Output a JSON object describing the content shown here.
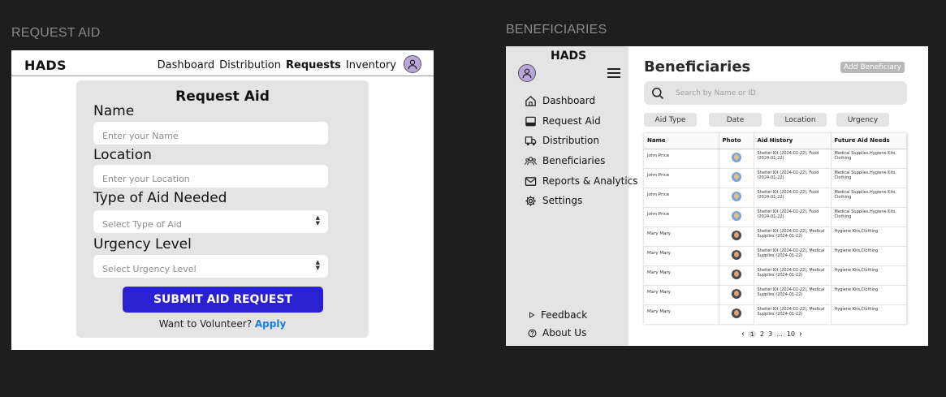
{
  "frames": {
    "left_label": "REQUEST AID",
    "right_label": "BENEFICIARIES"
  },
  "request": {
    "brand": "HADS",
    "nav": [
      "Dashboard",
      "Distribution",
      "Requests",
      "Inventory"
    ],
    "active_nav": "Requests",
    "title": "Request Aid",
    "fields": [
      {
        "label": "Name",
        "placeholder": "Enter your Name"
      },
      {
        "label": "Location",
        "placeholder": "Enter your Location"
      },
      {
        "label": "Type of Aid Needed",
        "placeholder": "Select Type of Aid"
      },
      {
        "label": "Urgency Level",
        "placeholder": "Select  Urgency Level"
      }
    ],
    "submit_label": "SUBMIT AID REQUEST",
    "volunteer_text": "Want to Volunteer?",
    "volunteer_link": "Apply"
  },
  "beneficiaries": {
    "brand": "HADS",
    "sidebar": [
      {
        "label": "Dashboard",
        "icon": "home-icon"
      },
      {
        "label": "Request Aid",
        "icon": "inbox-icon"
      },
      {
        "label": "Distribution",
        "icon": "truck-icon"
      },
      {
        "label": "Beneficiaries",
        "icon": "users-icon"
      },
      {
        "label": "Reports & Analytics",
        "icon": "mail-icon"
      },
      {
        "label": "Settings",
        "icon": "gear-icon"
      }
    ],
    "footer": [
      {
        "label": "Feedback",
        "icon": "play-icon"
      },
      {
        "label": "About Us",
        "icon": "help-icon"
      }
    ],
    "title": "Beneficiaries",
    "add_label": "Add Beneficiary",
    "search_placeholder": "Search by Name or ID",
    "filters": [
      "Aid Type",
      "Date",
      "Location",
      "Urgency"
    ],
    "columns": [
      "Name",
      "Photo",
      "Aid History",
      "Future Aid Needs"
    ],
    "rows": [
      {
        "name": "John Price",
        "history": "Shelter Kit (2024-01-22), Food (2024-01-22)",
        "needs": "Medical Supplies,Hygiene Kits, Clothing"
      },
      {
        "name": "John Price",
        "history": "Shelter Kit (2024-01-22), Food (2024-01-22)",
        "needs": "Medical Supplies,Hygiene Kits, Clothing"
      },
      {
        "name": "John Price",
        "history": "Shelter Kit (2024-01-22), Food (2024-01-22)",
        "needs": "Medical Supplies,Hygiene Kits, Clothing"
      },
      {
        "name": "John Price",
        "history": "Shelter Kit (2024-01-22), Food (2024-01-22)",
        "needs": "Medical Supplies,Hygiene Kits, Clothing"
      },
      {
        "name": "Mary Mary",
        "history": "Shelter Kit (2024-01-22), Medical Supplies (2024-01-22)",
        "needs": "Hygiene Kits,Clothing"
      },
      {
        "name": "Mary Mary",
        "history": "Shelter Kit (2024-01-22), Medical Supplies (2024-01-22)",
        "needs": "Hygiene Kits,Clothing"
      },
      {
        "name": "Mary Mary",
        "history": "Shelter Kit (2024-01-22), Medical Supplies (2024-01-22)",
        "needs": "Hygiene Kits,Clothing"
      },
      {
        "name": "Mary Mary",
        "history": "Shelter Kit (2024-01-22), Medical Supplies (2024-01-22)",
        "needs": "Hygiene Kits,Clothing"
      },
      {
        "name": "Mary Mary",
        "history": "Shelter Kit (2024-01-22), Medical Supplies (2024-01-22)",
        "needs": "Hygiene Kits,Clothing"
      }
    ],
    "pager": {
      "current": "1",
      "pages": [
        "2",
        "3"
      ],
      "ellipsis": "...",
      "last": "10"
    }
  },
  "colors": {
    "accent": "#2b21d0",
    "link": "#1a7de6",
    "avatar": "#b7a6d9"
  }
}
